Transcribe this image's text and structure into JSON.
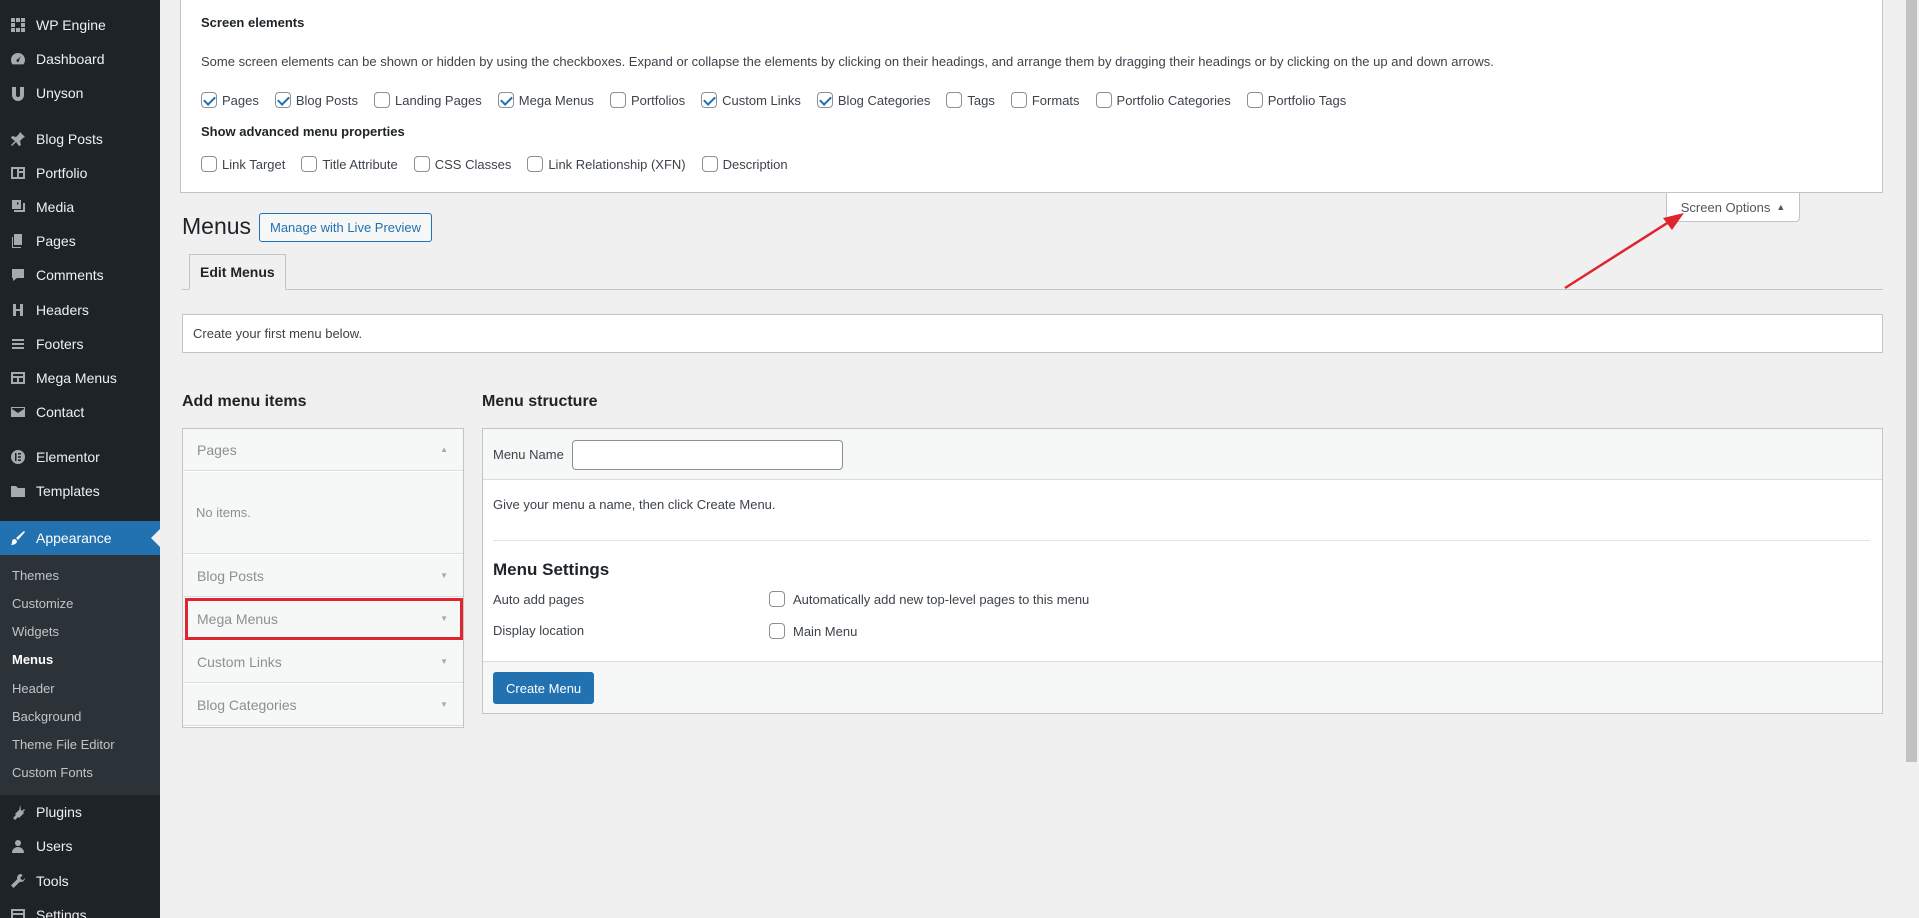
{
  "sidebar": {
    "items": [
      {
        "label": "WP Engine",
        "icon": "wp-engine-icon"
      },
      {
        "label": "Dashboard",
        "icon": "dashboard-icon"
      },
      {
        "label": "Unyson",
        "icon": "unyson-icon"
      },
      {
        "label": "Blog Posts",
        "icon": "pin-icon"
      },
      {
        "label": "Portfolio",
        "icon": "portfolio-icon"
      },
      {
        "label": "Media",
        "icon": "media-icon"
      },
      {
        "label": "Pages",
        "icon": "pages-icon"
      },
      {
        "label": "Comments",
        "icon": "comments-icon"
      },
      {
        "label": "Headers",
        "icon": "headers-icon"
      },
      {
        "label": "Footers",
        "icon": "footers-icon"
      },
      {
        "label": "Mega Menus",
        "icon": "table-icon"
      },
      {
        "label": "Contact",
        "icon": "mail-icon"
      },
      {
        "label": "Elementor",
        "icon": "elementor-icon"
      },
      {
        "label": "Templates",
        "icon": "folder-icon"
      },
      {
        "label": "Appearance",
        "icon": "brush-icon",
        "active": true
      },
      {
        "label": "Plugins",
        "icon": "plugins-icon"
      },
      {
        "label": "Users",
        "icon": "users-icon"
      },
      {
        "label": "Tools",
        "icon": "tools-icon"
      },
      {
        "label": "Settings",
        "icon": "settings-icon"
      }
    ],
    "submenu": [
      "Themes",
      "Customize",
      "Widgets",
      "Menus",
      "Header",
      "Background",
      "Theme File Editor",
      "Custom Fonts"
    ],
    "current_submenu": "Menus"
  },
  "screen_options": {
    "title": "Screen elements",
    "description": "Some screen elements can be shown or hidden by using the checkboxes. Expand or collapse the elements by clicking on their headings, and arrange them by dragging their headings or by clicking on the up and down arrows.",
    "elements": [
      {
        "label": "Pages",
        "checked": true
      },
      {
        "label": "Blog Posts",
        "checked": true
      },
      {
        "label": "Landing Pages",
        "checked": false
      },
      {
        "label": "Mega Menus",
        "checked": true
      },
      {
        "label": "Portfolios",
        "checked": false
      },
      {
        "label": "Custom Links",
        "checked": true
      },
      {
        "label": "Blog Categories",
        "checked": true
      },
      {
        "label": "Tags",
        "checked": false
      },
      {
        "label": "Formats",
        "checked": false
      },
      {
        "label": "Portfolio Categories",
        "checked": false
      },
      {
        "label": "Portfolio Tags",
        "checked": false
      }
    ],
    "advanced_title": "Show advanced menu properties",
    "advanced": [
      {
        "label": "Link Target",
        "checked": false
      },
      {
        "label": "Title Attribute",
        "checked": false
      },
      {
        "label": "CSS Classes",
        "checked": false
      },
      {
        "label": "Link Relationship (XFN)",
        "checked": false
      },
      {
        "label": "Description",
        "checked": false
      }
    ],
    "tab_label": "Screen Options"
  },
  "header": {
    "title": "Menus",
    "live_preview_label": "Manage with Live Preview",
    "tab_label": "Edit Menus"
  },
  "notice": "Create your first menu below.",
  "add_items": {
    "title": "Add menu items",
    "sections": [
      "Pages",
      "Blog Posts",
      "Mega Menus",
      "Custom Links",
      "Blog Categories"
    ],
    "empty_text": "No items."
  },
  "structure": {
    "title": "Menu structure",
    "name_label": "Menu Name",
    "name_value": "",
    "hint": "Give your menu a name, then click Create Menu.",
    "settings_title": "Menu Settings",
    "auto_add_label": "Auto add pages",
    "auto_add_option": "Automatically add new top-level pages to this menu",
    "display_label": "Display location",
    "display_option": "Main Menu",
    "create_button": "Create Menu"
  },
  "colors": {
    "sidebar_bg": "#1d2327",
    "accent": "#2271b1",
    "highlight": "#e0242d"
  }
}
